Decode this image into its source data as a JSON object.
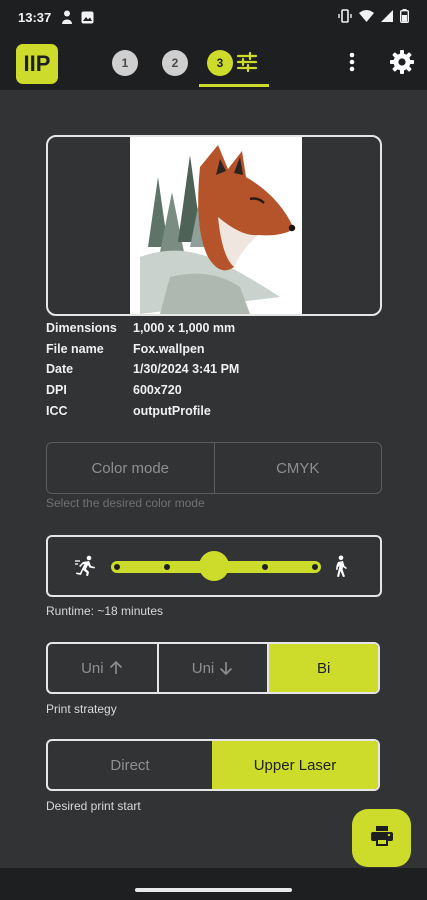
{
  "status_bar": {
    "time": "13:37",
    "icons": [
      "person-icon",
      "image-icon",
      "vibrate-icon",
      "wifi-icon",
      "signal-icon",
      "battery-icon"
    ]
  },
  "app_bar": {
    "logo_text": "IIP",
    "steps": [
      "1",
      "2",
      "3"
    ],
    "active_step": "3",
    "tab_icon": "tune-icon",
    "menu_icon": "more-vert-icon",
    "settings_icon": "gear-icon"
  },
  "preview": {
    "image_description_icon": "fox-image"
  },
  "metadata": [
    {
      "key": "Dimensions",
      "value": "1,000 x 1,000 mm"
    },
    {
      "key": "File name",
      "value": "Fox.wallpen"
    },
    {
      "key": "Date",
      "value": "1/30/2024 3:41 PM"
    },
    {
      "key": "DPI",
      "value": "600x720"
    },
    {
      "key": "ICC",
      "value": "outputProfile"
    }
  ],
  "color_mode": {
    "label": "Color mode",
    "value": "CMYK",
    "hint": "Select the desired color mode"
  },
  "speed": {
    "fast_icon": "running-icon",
    "slow_icon": "walking-icon",
    "position_index": 2,
    "stops": 5,
    "runtime": "Runtime: ~18 minutes"
  },
  "print_strategy": {
    "options": [
      {
        "label": "Uni",
        "icon": "arrow-up-icon",
        "selected": false
      },
      {
        "label": "Uni",
        "icon": "arrow-down-icon",
        "selected": false
      },
      {
        "label": "Bi",
        "icon": "",
        "selected": true
      }
    ],
    "caption": "Print strategy"
  },
  "print_start": {
    "options": [
      {
        "label": "Direct",
        "selected": false
      },
      {
        "label": "Upper Laser",
        "selected": true
      }
    ],
    "caption": "Desired print start"
  },
  "fab": {
    "icon": "print-icon"
  },
  "colors": {
    "accent": "#cddc2a",
    "background": "#313335",
    "bar": "#1e1f21"
  }
}
